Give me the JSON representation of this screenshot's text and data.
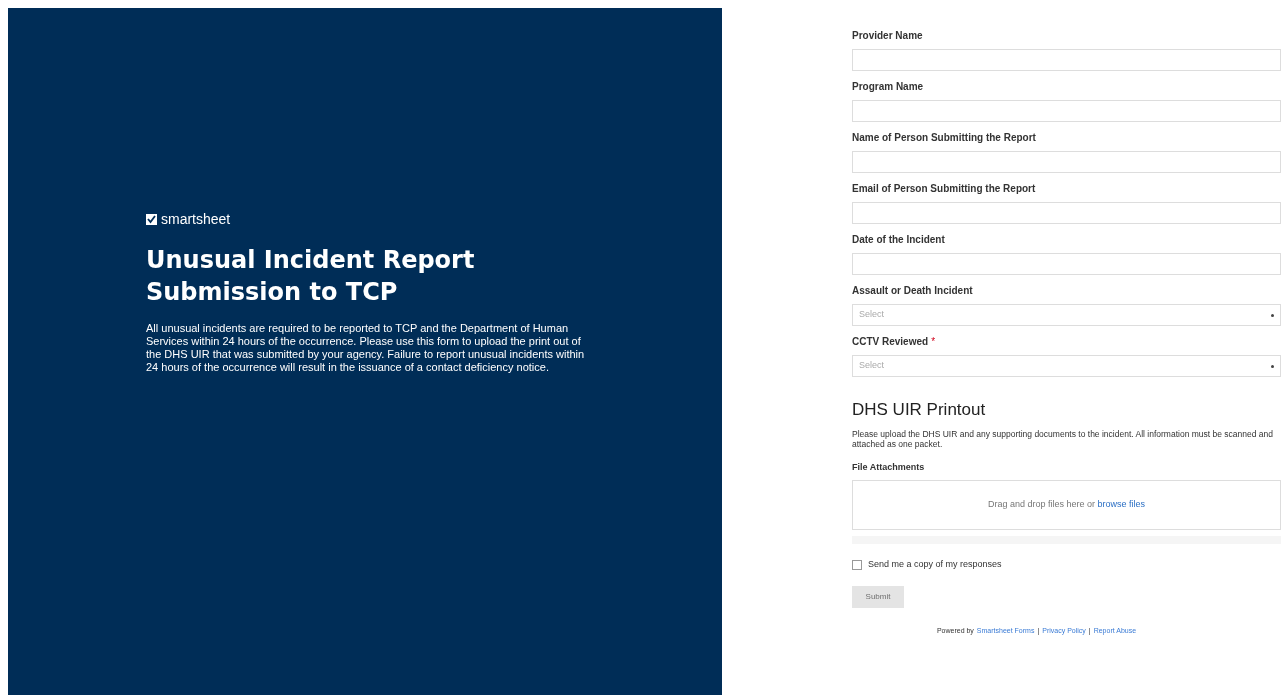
{
  "brand": {
    "logo_text": "smartsheet",
    "title": "Unusual Incident Report Submission to TCP",
    "description": "All unusual incidents are required to be reported to TCP and the Department of Human Services within 24 hours of the occurrence. Please use this form to upload the print out of the DHS UIR that was submitted by your agency. Failure to report unusual incidents within 24 hours of the occurrence will result in the issuance of a contact deficiency notice."
  },
  "fields": [
    {
      "kind": "text",
      "label": "Provider Name"
    },
    {
      "kind": "text",
      "label": "Program Name"
    },
    {
      "kind": "text",
      "label": "Name of Person Submitting the Report"
    },
    {
      "kind": "text",
      "label": "Email of Person Submitting the Report"
    },
    {
      "kind": "text",
      "label": "Date of the Incident"
    },
    {
      "kind": "select",
      "label": "Assault or Death Incident",
      "placeholder": "Select"
    },
    {
      "kind": "select",
      "label": "CCTV Reviewed",
      "required_marker": "*",
      "placeholder": "Select"
    }
  ],
  "section": {
    "heading": "DHS UIR Printout",
    "description": "Please upload the DHS UIR and any supporting documents to the incident. All information must be scanned and attached as one packet."
  },
  "attachments": {
    "label": "File Attachments",
    "prompt": "Drag and drop files here or",
    "link": "browse files"
  },
  "copy_checkbox": {
    "label": "Send me a copy of my responses",
    "checked": false
  },
  "submit": {
    "label": "Submit",
    "disabled": true
  },
  "footer": {
    "prefix": "Powered by",
    "links": [
      "Smartsheet Forms",
      "Privacy Policy",
      "Report Abuse"
    ],
    "separator": "|"
  }
}
